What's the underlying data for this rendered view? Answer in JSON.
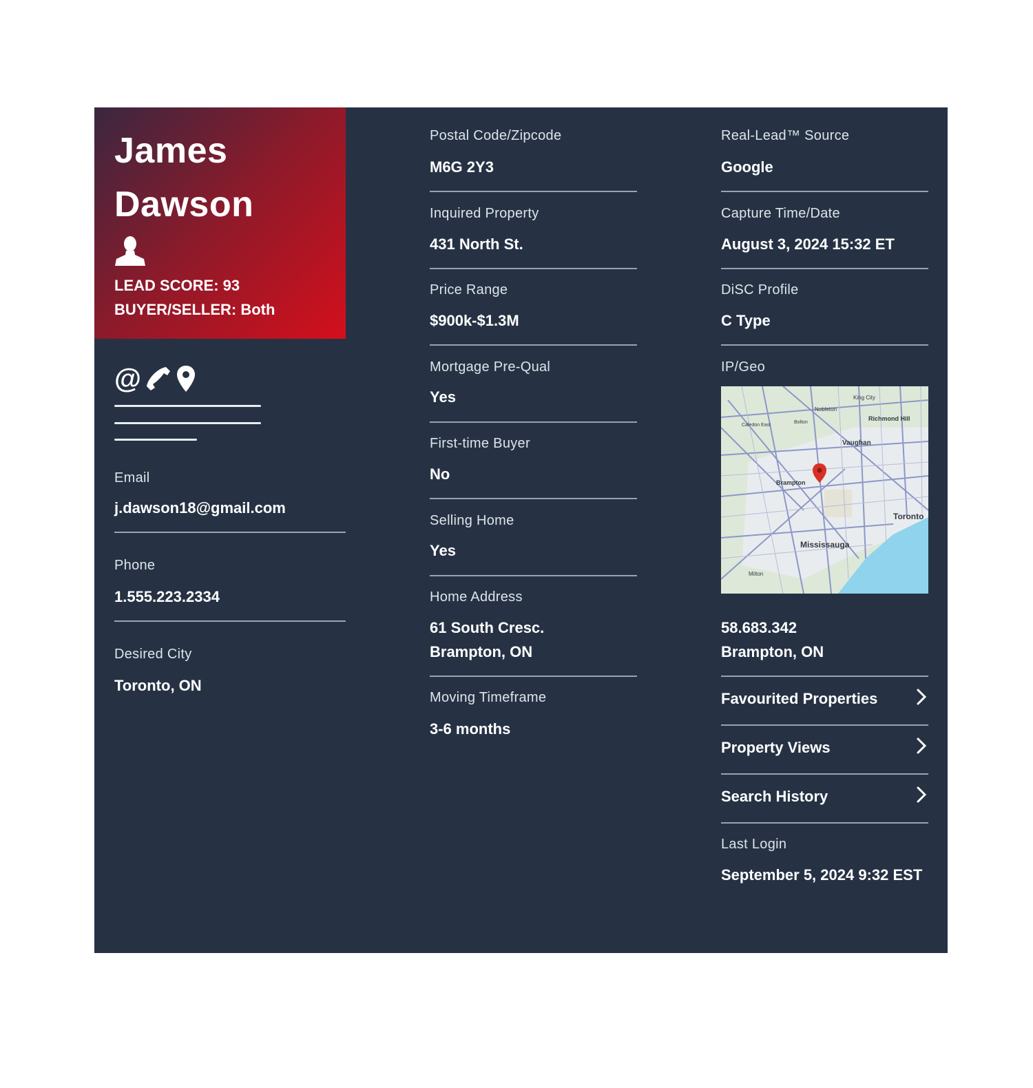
{
  "lead": {
    "first_name": "James",
    "last_name": "Dawson",
    "lead_score": "LEAD SCORE: 93",
    "buyer_seller": "BUYER/SELLER: Both"
  },
  "contact_icons": [
    "at-icon",
    "phone-icon",
    "location-pin-icon"
  ],
  "left_fields": [
    {
      "label": "Email",
      "value": "j.dawson18@gmail.com"
    },
    {
      "label": "Phone",
      "value": "1.555.223.2334"
    },
    {
      "label": "Desired City",
      "value": "Toronto, ON"
    }
  ],
  "middle_fields": [
    {
      "label": "Postal Code/Zipcode",
      "value": "M6G 2Y3"
    },
    {
      "label": "Inquired Property",
      "value": "431 North St."
    },
    {
      "label": "Price Range",
      "value": "$900k-$1.3M"
    },
    {
      "label": "Mortgage Pre-Qual",
      "value": "Yes"
    },
    {
      "label": "First-time Buyer",
      "value": "No"
    },
    {
      "label": "Selling Home",
      "value": "Yes"
    },
    {
      "label": "Home Address",
      "value_line1": "61 South Cresc.",
      "value_line2": "Brampton, ON"
    },
    {
      "label": "Moving Timeframe",
      "value": "3-6 months"
    }
  ],
  "right_fields": [
    {
      "label": "Real-Lead™ Source",
      "value": "Google"
    },
    {
      "label": "Capture Time/Date",
      "value": "August 3, 2024 15:32 ET"
    },
    {
      "label": "DiSC Profile",
      "value": "C Type"
    },
    {
      "label": "IP/Geo"
    }
  ],
  "map": {
    "labels": [
      "King City",
      "Nobleton",
      "Richmond Hill",
      "Caledon East",
      "Bolton",
      "Vaughan",
      "Brampton",
      "Toronto",
      "Mississauga",
      "Milton"
    ],
    "water_color": "#8fd3ec",
    "land_color": "#dfe8dc",
    "pin_color": "#d93025"
  },
  "geo": {
    "ip": "58.683.342",
    "location": "Brampton, ON"
  },
  "nav_links": [
    "Favourited Properties",
    "Property Views",
    "Search History"
  ],
  "last_login": {
    "label": "Last Login",
    "value": "September 5, 2024 9:32 EST"
  },
  "colors": {
    "card_bg": "#263244",
    "accent_red": "#d40f1c"
  }
}
